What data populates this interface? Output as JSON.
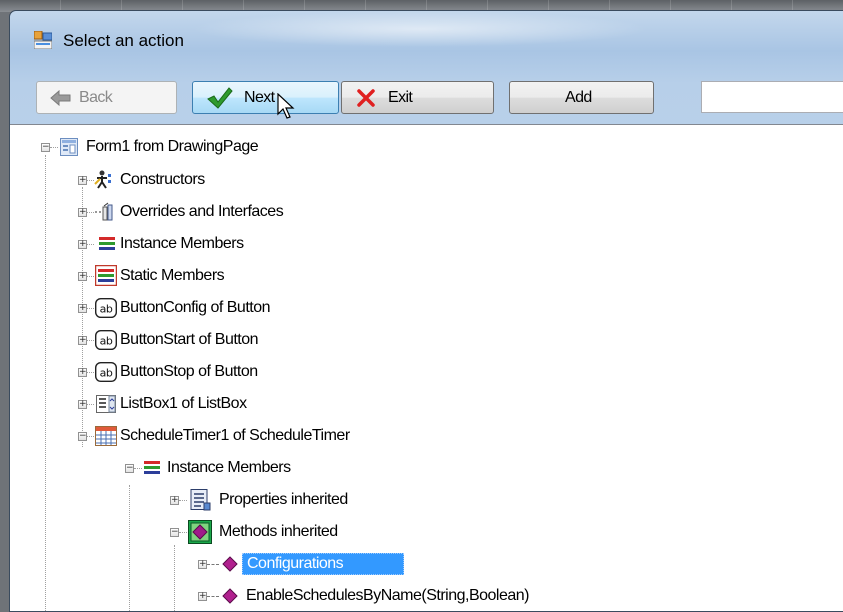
{
  "window": {
    "title": "Select an action"
  },
  "toolbar": {
    "back_label": "Back",
    "next_label": "Next",
    "exit_label": "Exit",
    "add_label": "Add",
    "search_value": ""
  },
  "tree": {
    "root": "Form1 from DrawingPage",
    "items": [
      "Constructors",
      "Overrides and Interfaces",
      "Instance Members",
      "Static Members",
      "ButtonConfig of Button",
      "ButtonStart of Button",
      "ButtonStop of Button",
      "ListBox1 of ListBox",
      "ScheduleTimer1 of ScheduleTimer"
    ],
    "sub_instance": "Instance Members",
    "properties": "Properties inherited",
    "methods": "Methods inherited",
    "configurations": "Configurations",
    "enable_schedules": "EnableSchedulesByName(String,Boolean)"
  },
  "colors": {
    "selection": "#3399ff",
    "titlebar": "#b7cfe9",
    "tree_background": "#ffffff"
  },
  "icons": {
    "app": "app-window-icon",
    "back": "back-arrow-icon",
    "next": "green-check-icon",
    "exit": "red-x-icon",
    "form": "form-icon",
    "constructors": "constructors-icon",
    "overrides": "overrides-icon",
    "instance": "instance-members-icon",
    "static": "static-members-icon",
    "button": "textbox-ab-icon",
    "listbox": "listbox-icon",
    "timer": "calendar-icon",
    "properties": "properties-icon",
    "methods": "methods-icon",
    "method": "method-diamond-icon"
  }
}
